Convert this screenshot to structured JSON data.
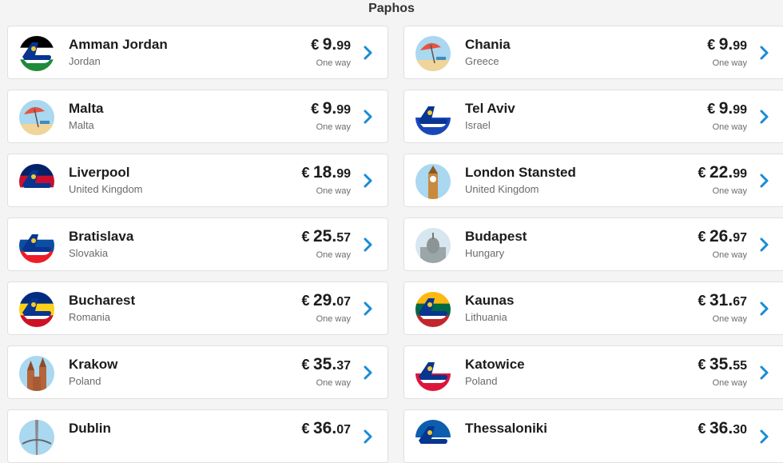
{
  "header": {
    "title": "Paphos"
  },
  "destinations": [
    {
      "city": "Amman Jordan",
      "country": "Jordan",
      "currency": "€",
      "price_int": "9.",
      "price_dec": "99",
      "fare_type": "One way",
      "icon": "plane-flag-jordan-icon",
      "colors": [
        "#000000",
        "#ffffff",
        "#1f8a3a",
        "#d52b1e"
      ]
    },
    {
      "city": "Chania",
      "country": "Greece",
      "currency": "€",
      "price_int": "9.",
      "price_dec": "99",
      "fare_type": "One way",
      "icon": "beach-umbrella-icon",
      "colors": [
        "#a9d8f0",
        "#f0d49a",
        "#e8523f"
      ]
    },
    {
      "city": "Malta",
      "country": "Malta",
      "currency": "€",
      "price_int": "9.",
      "price_dec": "99",
      "fare_type": "One way",
      "icon": "beach-umbrella-icon",
      "colors": [
        "#a9d8f0",
        "#f0d49a",
        "#e8523f"
      ]
    },
    {
      "city": "Tel Aviv",
      "country": "Israel",
      "currency": "€",
      "price_int": "9.",
      "price_dec": "99",
      "fare_type": "One way",
      "icon": "plane-flag-israel-icon",
      "colors": [
        "#ffffff",
        "#1a47b8"
      ]
    },
    {
      "city": "Liverpool",
      "country": "United Kingdom",
      "currency": "€",
      "price_int": "18.",
      "price_dec": "99",
      "fare_type": "One way",
      "icon": "plane-flag-uk-icon",
      "colors": [
        "#012169",
        "#c8102e",
        "#ffffff"
      ]
    },
    {
      "city": "London Stansted",
      "country": "United Kingdom",
      "currency": "€",
      "price_int": "22.",
      "price_dec": "99",
      "fare_type": "One way",
      "icon": "big-ben-icon",
      "colors": [
        "#a9d8f0",
        "#c98a3c"
      ]
    },
    {
      "city": "Bratislava",
      "country": "Slovakia",
      "currency": "€",
      "price_int": "25.",
      "price_dec": "57",
      "fare_type": "One way",
      "icon": "plane-flag-slovakia-icon",
      "colors": [
        "#ffffff",
        "#0b4ea2",
        "#ee1c25"
      ]
    },
    {
      "city": "Budapest",
      "country": "Hungary",
      "currency": "€",
      "price_int": "26.",
      "price_dec": "97",
      "fare_type": "One way",
      "icon": "parliament-icon",
      "colors": [
        "#d8e6ef",
        "#9aa6a8"
      ]
    },
    {
      "city": "Bucharest",
      "country": "Romania",
      "currency": "€",
      "price_int": "29.",
      "price_dec": "07",
      "fare_type": "One way",
      "icon": "plane-flag-romania-icon",
      "colors": [
        "#002b7f",
        "#fcd116",
        "#ce1126"
      ]
    },
    {
      "city": "Kaunas",
      "country": "Lithuania",
      "currency": "€",
      "price_int": "31.",
      "price_dec": "67",
      "fare_type": "One way",
      "icon": "plane-flag-lithuania-icon",
      "colors": [
        "#fdb913",
        "#006a44",
        "#c1272d"
      ]
    },
    {
      "city": "Krakow",
      "country": "Poland",
      "currency": "€",
      "price_int": "35.",
      "price_dec": "37",
      "fare_type": "One way",
      "icon": "church-icon",
      "colors": [
        "#a9d8f0",
        "#b5653c"
      ]
    },
    {
      "city": "Katowice",
      "country": "Poland",
      "currency": "€",
      "price_int": "35.",
      "price_dec": "55",
      "fare_type": "One way",
      "icon": "plane-flag-poland-icon",
      "colors": [
        "#ffffff",
        "#dc143c"
      ]
    },
    {
      "city": "Dublin",
      "country": "",
      "currency": "€",
      "price_int": "36.",
      "price_dec": "07",
      "fare_type": "",
      "icon": "spire-icon",
      "colors": [
        "#a9d8f0",
        "#8a8a8a"
      ]
    },
    {
      "city": "Thessaloniki",
      "country": "",
      "currency": "€",
      "price_int": "36.",
      "price_dec": "30",
      "fare_type": "",
      "icon": "plane-flag-greece-icon",
      "colors": [
        "#0d5eaf",
        "#ffffff"
      ]
    }
  ],
  "accent_color": "#1a8ad8",
  "chevron_icon": "chevron-right-icon"
}
